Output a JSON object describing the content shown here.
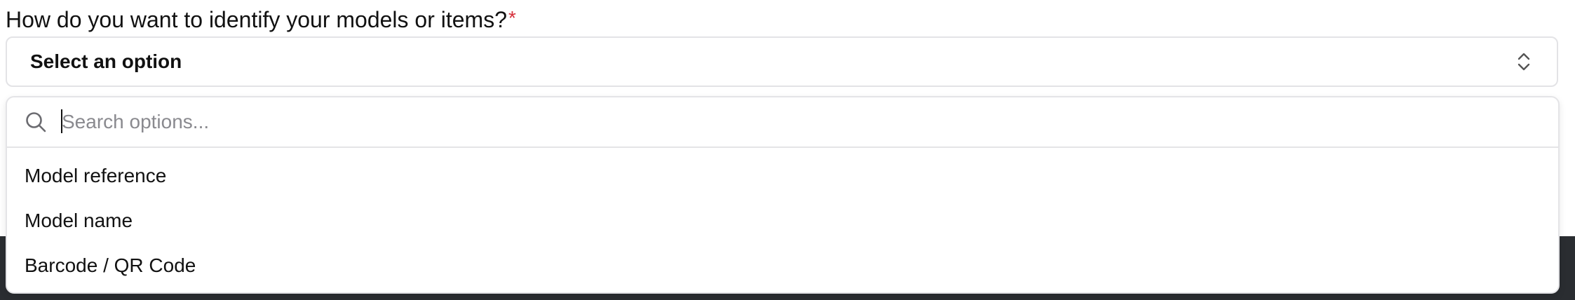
{
  "form": {
    "question": "How do you want to identify your models or items?",
    "required_mark": "*",
    "select": {
      "value": "Select an option",
      "chevron_icon": "chevron-up-down-icon"
    }
  },
  "dropdown": {
    "search": {
      "placeholder": "Search options...",
      "icon": "search-icon"
    },
    "options": [
      {
        "label": "Model reference"
      },
      {
        "label": "Model name"
      },
      {
        "label": "Barcode / QR Code"
      }
    ]
  },
  "colors": {
    "required": "#d62f3a",
    "background_band": "#2a2d31",
    "border": "#e3e3e6",
    "placeholder": "#8a8a8f"
  }
}
